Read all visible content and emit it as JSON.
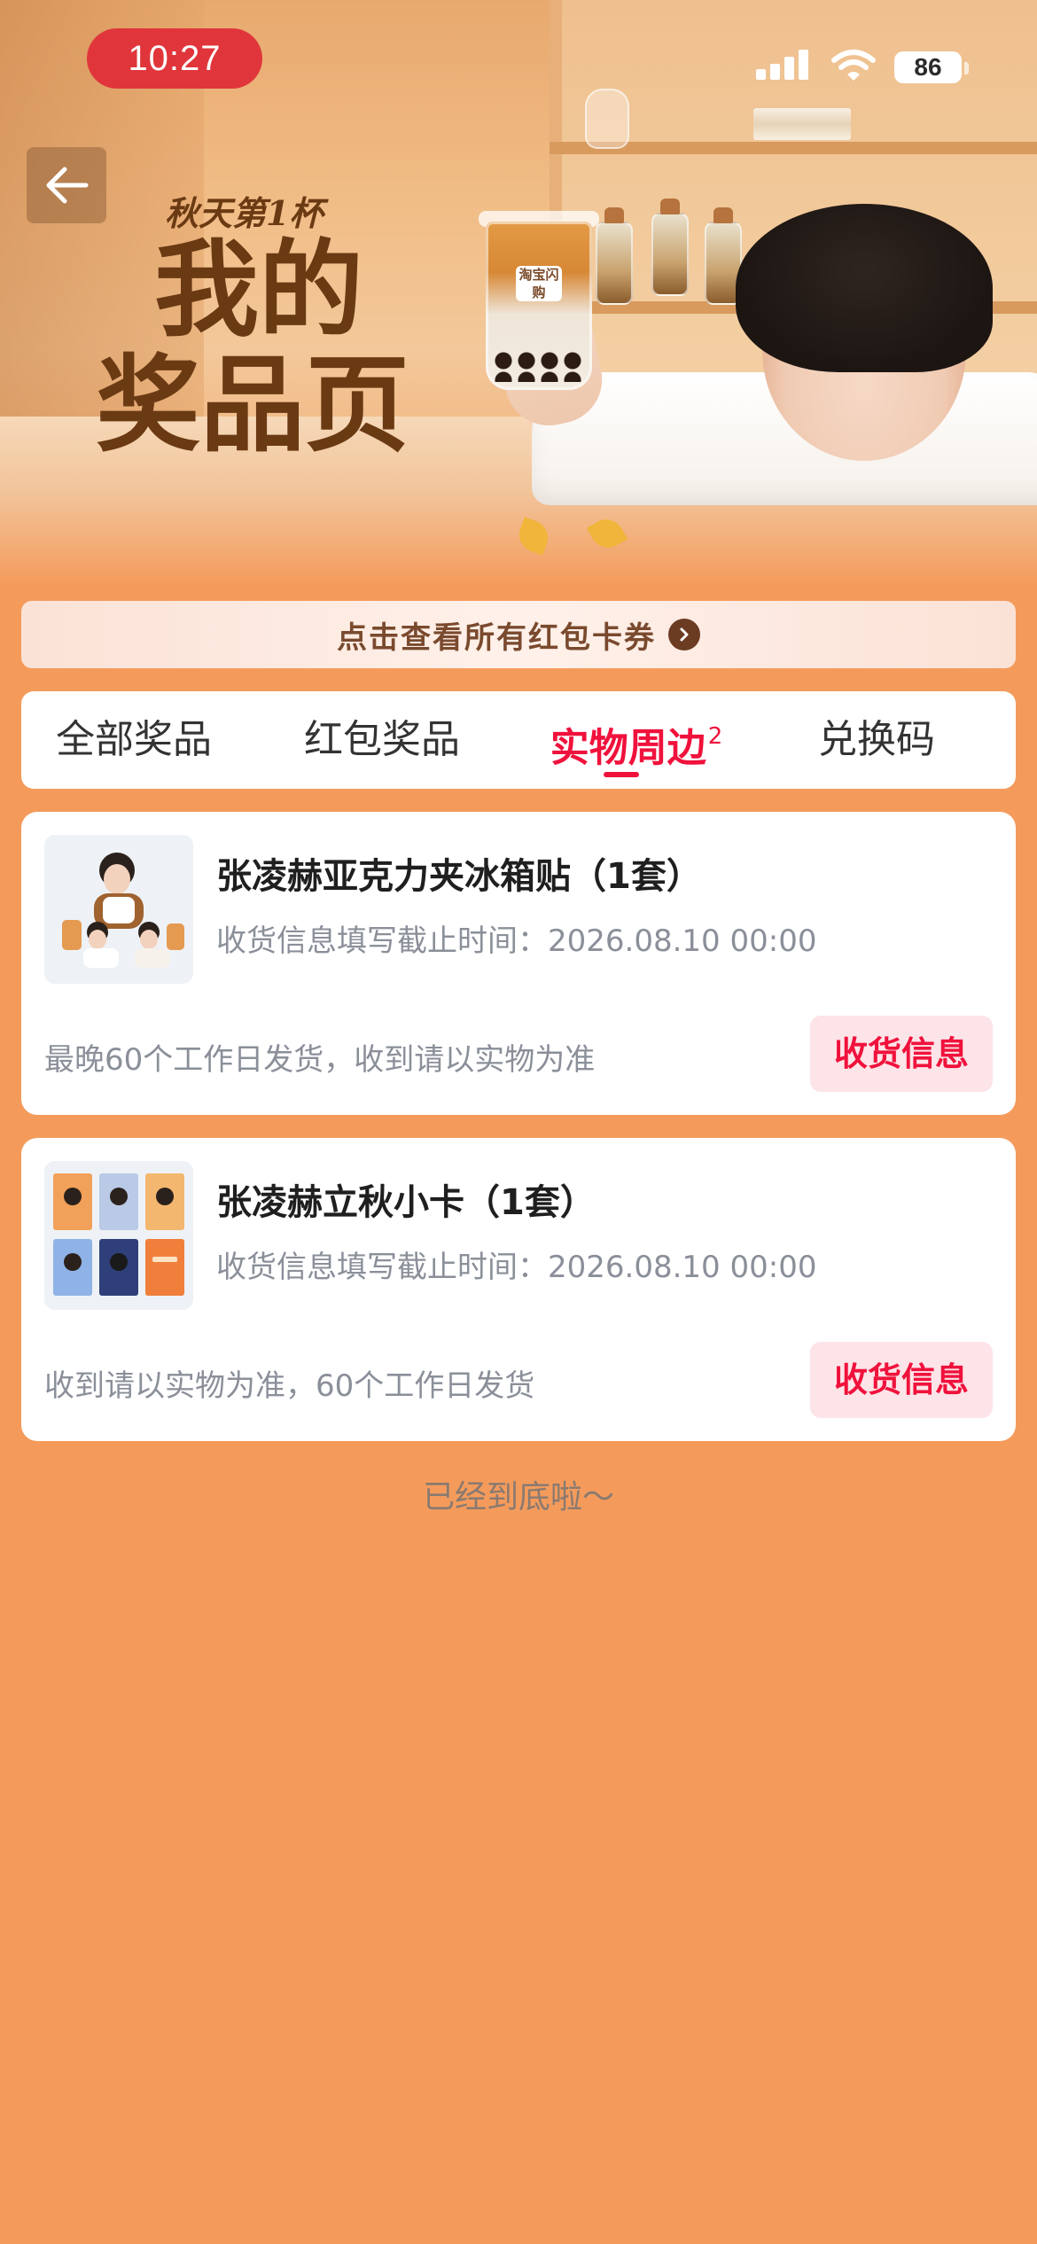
{
  "status_bar": {
    "time": "10:27",
    "battery": "86"
  },
  "hero": {
    "subtitle": "秋天第1杯",
    "title_line1": "我的",
    "title_line2": "奖品页",
    "cup_label": "淘宝闪购"
  },
  "coupon_bar": {
    "label": "点击查看所有红包卡券"
  },
  "tabs": [
    {
      "label": "全部奖品",
      "active": false
    },
    {
      "label": "红包奖品",
      "active": false
    },
    {
      "label": "实物周边",
      "badge": "2",
      "active": true
    },
    {
      "label": "兑换码",
      "active": false
    }
  ],
  "prizes": [
    {
      "title": "张凌赫亚克力夹冰箱贴（1套）",
      "deadline": "收货信息填写截止时间：2026.08.10 00:00",
      "note": "最晚60个工作日发货，收到请以实物为准",
      "button": "收货信息"
    },
    {
      "title": "张凌赫立秋小卡（1套）",
      "deadline": "收货信息填写截止时间：2026.08.10 00:00",
      "note": "收到请以实物为准，60个工作日发货",
      "button": "收货信息"
    }
  ],
  "footer": "已经到底啦～",
  "colors": {
    "background": "#f49b5c",
    "accent": "#f0123c",
    "time_pill": "#e0363b",
    "hero_text": "#6a3a13"
  },
  "icons": {
    "back": "arrow-left-icon",
    "coupon_arrow": "chevron-right-circle-icon",
    "signal": "cellular-signal-icon",
    "wifi": "wifi-icon",
    "battery": "battery-icon"
  }
}
